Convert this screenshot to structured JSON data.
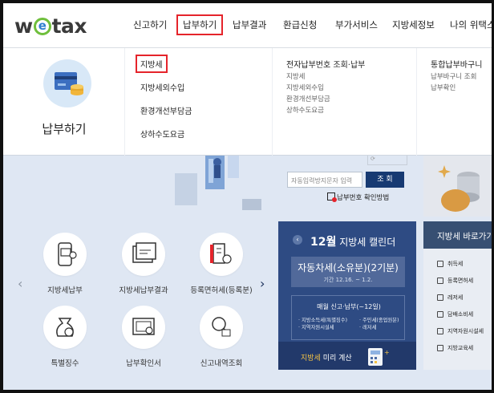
{
  "header": {
    "logo": "wetax",
    "nav": [
      "신고하기",
      "납부하기",
      "납부결과",
      "환급신청",
      "부가서비스",
      "지방세정보",
      "나의 위택스"
    ]
  },
  "dropdown": {
    "title": "납부하기",
    "col1": [
      "지방세",
      "지방세외수입",
      "환경개선부담금",
      "상하수도요금"
    ],
    "col2": {
      "heading": "전자납부번호 조회·납부",
      "items": [
        "지방세",
        "지방세외수입",
        "환경개선부담금",
        "상하수도요금"
      ]
    },
    "col3": {
      "heading": "통합납부바구니",
      "items": [
        "납부바구니 조회",
        "납부확인"
      ]
    }
  },
  "search": {
    "placeholder": "자동입력방지문자 입력",
    "button": "조 회",
    "hint": "납부번호 확인방법"
  },
  "services": [
    {
      "label": "지방세납부",
      "icon": "phone-payment-icon"
    },
    {
      "label": "지방세납부결과",
      "icon": "folder-result-icon"
    },
    {
      "label": "등록면허세(등록분)",
      "icon": "building-tax-icon"
    },
    {
      "label": "특별징수",
      "icon": "money-bag-icon"
    },
    {
      "label": "납부확인서",
      "icon": "certificate-icon"
    },
    {
      "label": "신고내역조회",
      "icon": "search-history-icon"
    }
  ],
  "calendar": {
    "month": "12월",
    "title": "지방세 캘린더",
    "main": "자동차세(소유분)(2기분)",
    "period": "기간 12.16. ~ 1.2.",
    "box_title": "매월 신고·납부(~12일)",
    "list_left": [
      "지방소득세(특별징수)",
      "지역자원시설세"
    ],
    "list_right": [
      "주민세(종업원분)",
      "레저세"
    ],
    "footer_highlight": "지방세",
    "footer_text": " 미리 계산"
  },
  "right_panel": {
    "title": "지방세 바로가기",
    "items": [
      "취득세",
      "등록면허세",
      "레저세",
      "담배소비세",
      "지역자원시설세",
      "지방교육세"
    ]
  },
  "colors": {
    "accent_red": "#e5242b",
    "navy": "#2e4b83",
    "dark_navy": "#173a72",
    "logo_green": "#6fbf3c"
  }
}
